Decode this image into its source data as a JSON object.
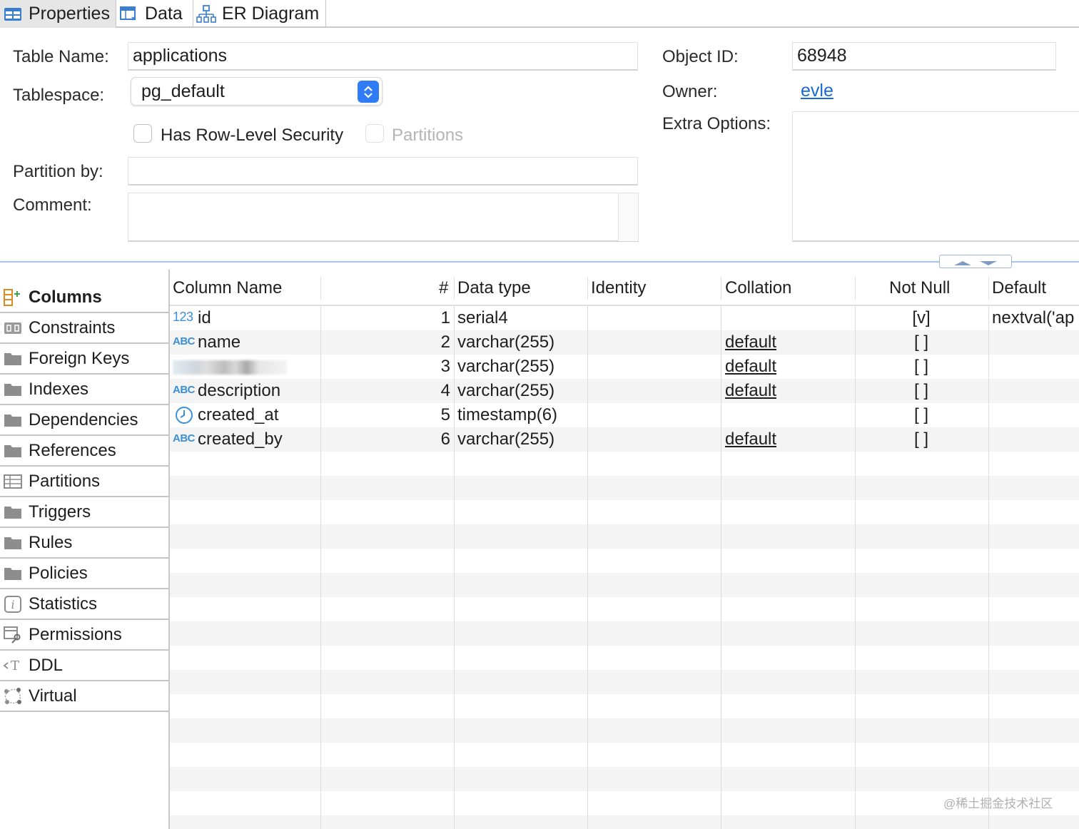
{
  "tabs": [
    {
      "label": "Properties",
      "icon": "properties-icon"
    },
    {
      "label": "Data",
      "icon": "data-grid-icon"
    },
    {
      "label": "ER Diagram",
      "icon": "er-diagram-icon"
    }
  ],
  "form": {
    "table_name_label": "Table Name:",
    "table_name_value": "applications",
    "tablespace_label": "Tablespace:",
    "tablespace_value": "pg_default",
    "row_level_security_label": "Has Row-Level Security",
    "row_level_security_checked": false,
    "partitions_label": "Partitions",
    "partitions_enabled": false,
    "partition_by_label": "Partition by:",
    "partition_by_value": "",
    "comment_label": "Comment:",
    "comment_value": "",
    "object_id_label": "Object ID:",
    "object_id_value": "68948",
    "owner_label": "Owner:",
    "owner_value": "evle",
    "extra_options_label": "Extra Options:",
    "extra_options_value": ""
  },
  "sidebar": {
    "items": [
      {
        "label": "Columns",
        "icon": "columns-icon",
        "active": true
      },
      {
        "label": "Constraints",
        "icon": "constraints-icon"
      },
      {
        "label": "Foreign Keys",
        "icon": "folder-icon"
      },
      {
        "label": "Indexes",
        "icon": "folder-icon"
      },
      {
        "label": "Dependencies",
        "icon": "folder-icon"
      },
      {
        "label": "References",
        "icon": "folder-icon"
      },
      {
        "label": "Partitions",
        "icon": "partitions-icon"
      },
      {
        "label": "Triggers",
        "icon": "folder-icon"
      },
      {
        "label": "Rules",
        "icon": "folder-icon"
      },
      {
        "label": "Policies",
        "icon": "folder-icon"
      },
      {
        "label": "Statistics",
        "icon": "info-icon"
      },
      {
        "label": "Permissions",
        "icon": "permissions-icon"
      },
      {
        "label": "DDL",
        "icon": "ddl-icon"
      },
      {
        "label": "Virtual",
        "icon": "virtual-icon"
      }
    ]
  },
  "columns_table": {
    "headers": [
      "Column Name",
      "#",
      "Data type",
      "Identity",
      "Collation",
      "Not Null",
      "Default"
    ],
    "rows": [
      {
        "type_icon": "123",
        "name": "id",
        "num": "1",
        "data_type": "serial4",
        "identity": "",
        "collation": "",
        "not_null": "[v]",
        "default": "nextval('ap"
      },
      {
        "type_icon": "ABC",
        "name": "name",
        "num": "2",
        "data_type": "varchar(255)",
        "identity": "",
        "collation": "default",
        "not_null": "[ ]",
        "default": ""
      },
      {
        "type_icon": "",
        "name": "",
        "num": "3",
        "data_type": "varchar(255)",
        "identity": "",
        "collation": "default",
        "not_null": "[ ]",
        "default": ""
      },
      {
        "type_icon": "ABC",
        "name": "description",
        "num": "4",
        "data_type": "varchar(255)",
        "identity": "",
        "collation": "default",
        "not_null": "[ ]",
        "default": ""
      },
      {
        "type_icon": "clock",
        "name": "created_at",
        "num": "5",
        "data_type": "timestamp(6)",
        "identity": "",
        "collation": "",
        "not_null": "[ ]",
        "default": ""
      },
      {
        "type_icon": "ABC",
        "name": "created_by",
        "num": "6",
        "data_type": "varchar(255)",
        "identity": "",
        "collation": "default",
        "not_null": "[ ]",
        "default": ""
      }
    ]
  },
  "watermark": "@稀土掘金技术社区",
  "colors": {
    "accent": "#2f7cf6",
    "link": "#1a6ad4",
    "type_icon": "#3b8fd6"
  }
}
